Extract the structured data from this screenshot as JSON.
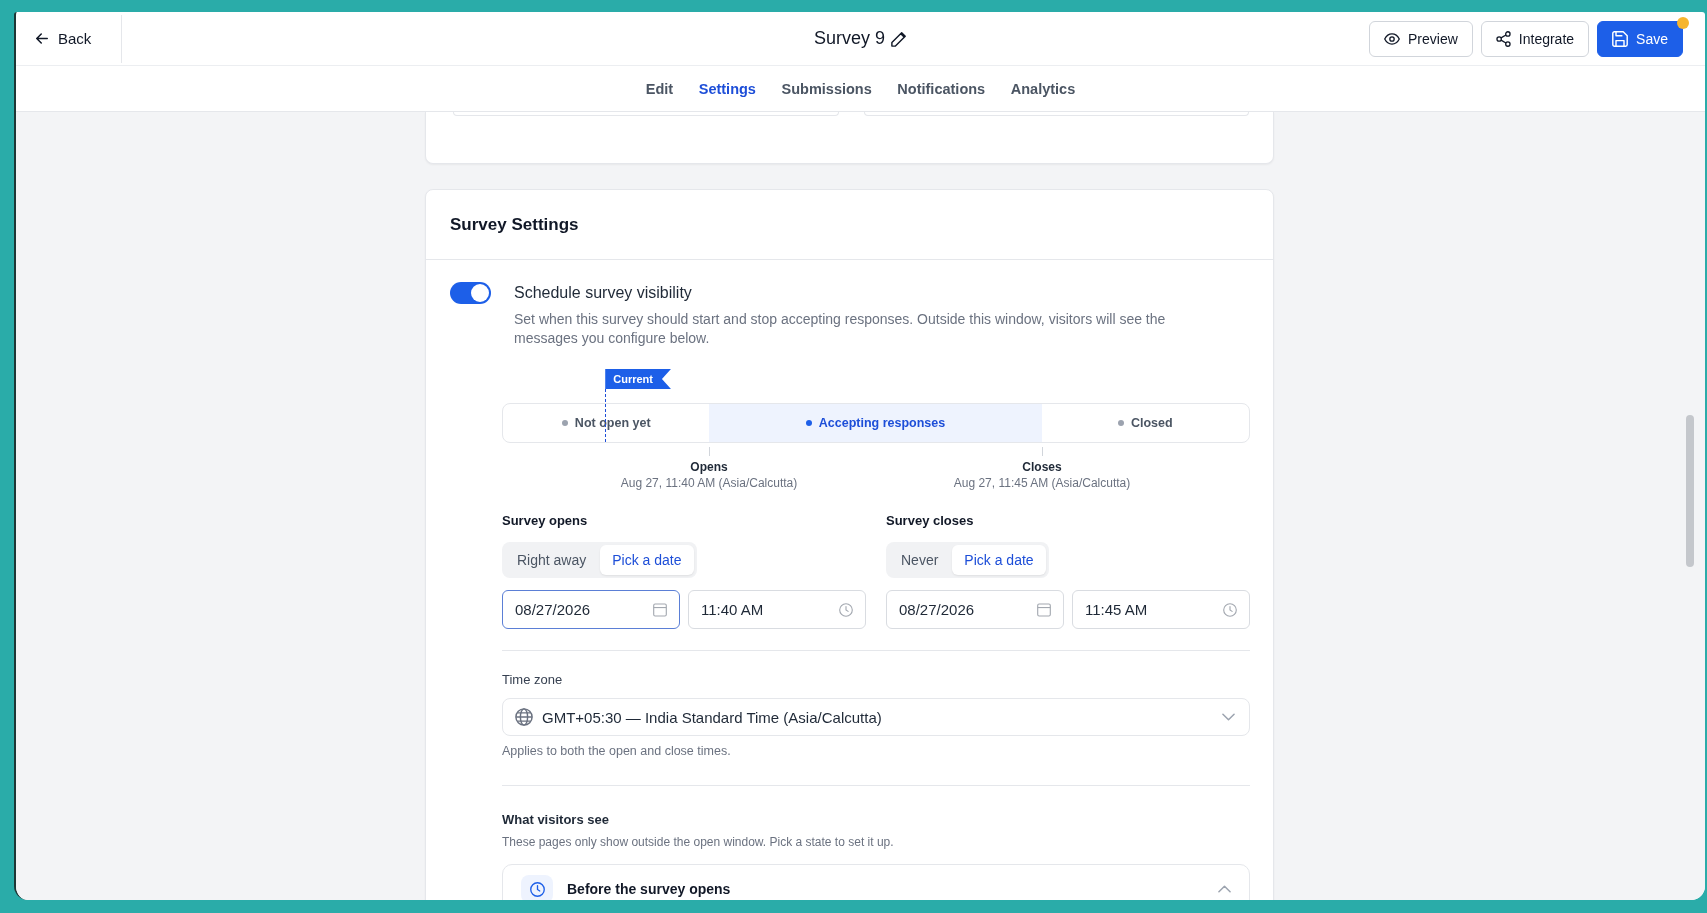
{
  "header": {
    "back": "Back",
    "title": "Survey 9",
    "buttons": [
      {
        "label": "Preview",
        "kind": "outline",
        "unsaved": false
      },
      {
        "label": "Integrate",
        "kind": "outline",
        "unsaved": false
      },
      {
        "label": "Save",
        "kind": "primary",
        "unsaved": true
      }
    ]
  },
  "tabs": [
    {
      "label": "Edit",
      "selected": false
    },
    {
      "label": "Settings",
      "selected": true
    },
    {
      "label": "Submissions",
      "selected": false
    },
    {
      "label": "Notifications",
      "selected": false
    },
    {
      "label": "Analytics",
      "selected": false
    }
  ],
  "survey_settings": {
    "title": "Survey Settings",
    "schedule": {
      "on": true,
      "label": "Schedule survey visibility",
      "description": "Set when this survey should start and stop accepting responses. Outside this window, visitors will see the messages you configure below."
    },
    "timeline": {
      "marker": "Current",
      "segments": [
        {
          "label": "Not open yet",
          "highlighted": false
        },
        {
          "label": "Accepting responses",
          "highlighted": true
        },
        {
          "label": "Closed",
          "highlighted": false
        }
      ],
      "bounds": [
        {
          "label": "Opens",
          "time": "Aug 27, 11:40 AM (Asia/Calcutta)"
        },
        {
          "label": "Closes",
          "time": "Aug 27, 11:45 AM (Asia/Calcutta)"
        }
      ]
    },
    "windows": [
      {
        "label": "Survey opens",
        "options": [
          {
            "label": "Right away",
            "selected": false
          },
          {
            "label": "Pick a date",
            "selected": true
          }
        ],
        "date": "08/27/2026",
        "date_focused": true,
        "time": "11:40 AM"
      },
      {
        "label": "Survey closes",
        "options": [
          {
            "label": "Never",
            "selected": false
          },
          {
            "label": "Pick a date",
            "selected": true
          }
        ],
        "date": "08/27/2026",
        "date_focused": false,
        "time": "11:45 AM"
      }
    ],
    "time_zone": {
      "label": "Time zone",
      "value": "GMT+05:30 — India Standard Time (Asia/Calcutta)",
      "hint": "Applies to both the open and close times."
    },
    "visitors": {
      "title": "What visitors see",
      "description": "These pages only show outside the open window. Pick a state to set it up.",
      "items": [
        {
          "title": "Before the survey opens",
          "expanded": true
        }
      ]
    }
  }
}
